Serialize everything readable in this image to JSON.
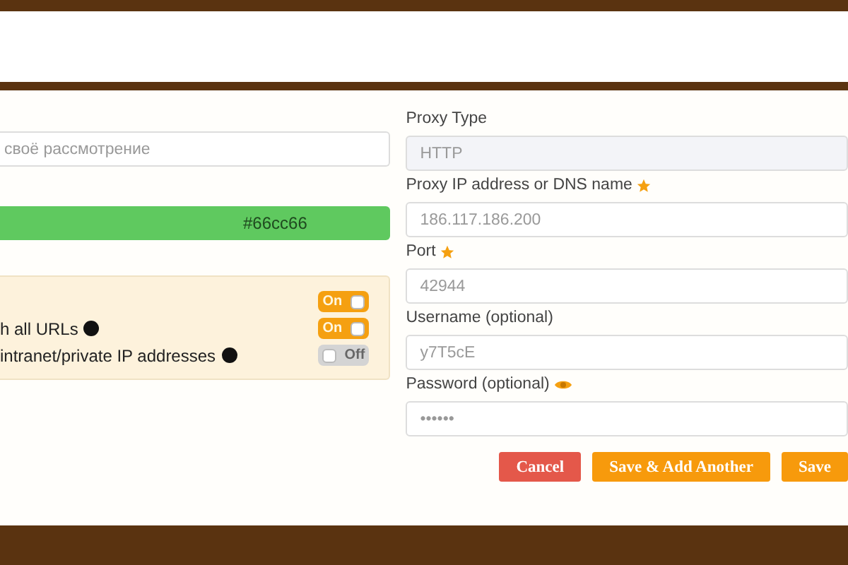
{
  "left": {
    "title_field": {
      "value": "своё рассмотрение"
    },
    "color_field": {
      "value": "#66cc66",
      "color": "#5fc95f"
    },
    "options": [
      {
        "on": true,
        "state_text": "On"
      },
      {
        "label": "h all URLs",
        "on": true,
        "state_text": "On",
        "info": true
      },
      {
        "label": "intranet/private IP addresses",
        "on": false,
        "state_text": "Off",
        "info": true
      }
    ]
  },
  "right": {
    "fields": [
      {
        "label": "Proxy Type",
        "value": "HTTP",
        "required": false,
        "kind": "select"
      },
      {
        "label": "Proxy IP address or DNS name",
        "value": "186.117.186.200",
        "required": true,
        "kind": "text"
      },
      {
        "label": "Port",
        "value": "42944",
        "required": true,
        "kind": "text"
      },
      {
        "label": "Username (optional)",
        "value": "y7T5cE",
        "required": false,
        "kind": "text"
      },
      {
        "label": "Password (optional)",
        "value": "••••••",
        "required": false,
        "kind": "password"
      }
    ]
  },
  "buttons": [
    {
      "label": "Cancel",
      "kind": "danger"
    },
    {
      "label": "Save & Add Another",
      "kind": "primary"
    },
    {
      "label": "Save",
      "kind": "primary"
    }
  ]
}
